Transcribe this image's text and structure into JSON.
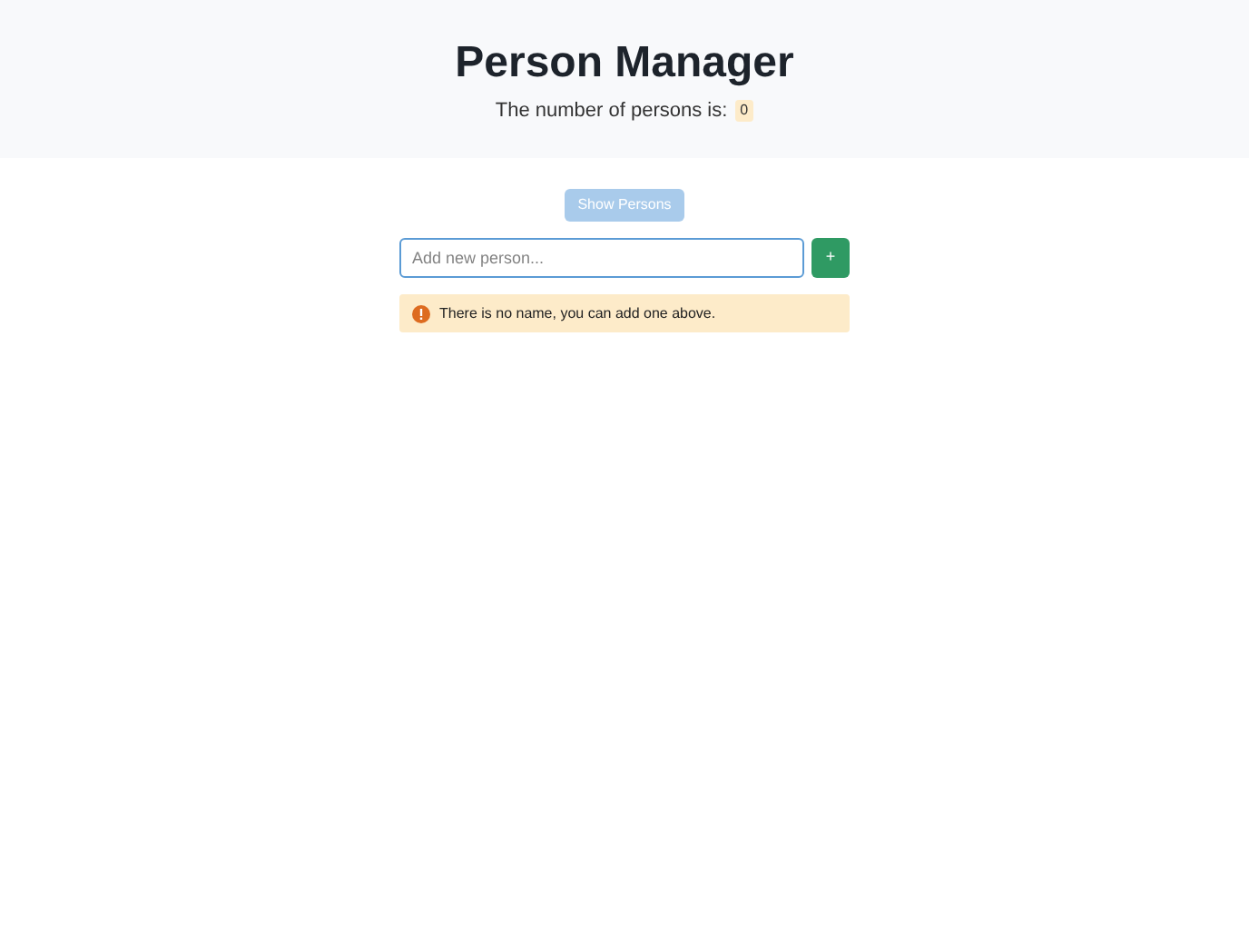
{
  "header": {
    "title": "Person Manager",
    "count_label": "The number of persons is:",
    "count": "0"
  },
  "show_button": {
    "label": "Show Persons",
    "disabled": true
  },
  "input": {
    "placeholder": "Add new person...",
    "focused": true
  },
  "add_button": {
    "label": "+"
  },
  "alert": {
    "text": "There is no name, you can add one above."
  }
}
